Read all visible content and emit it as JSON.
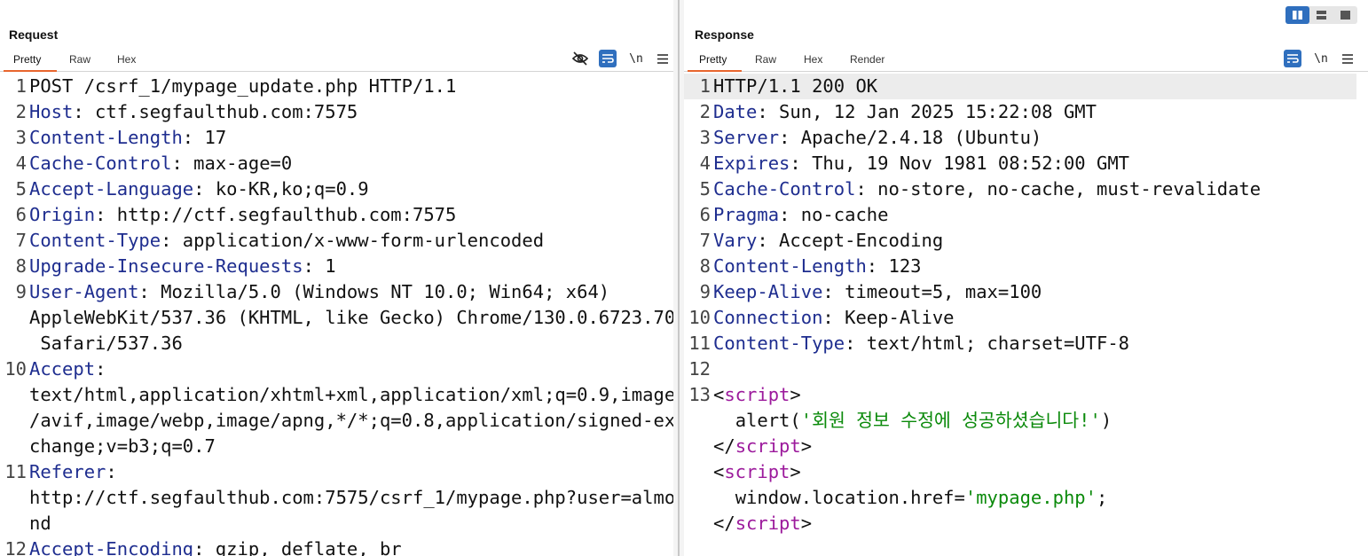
{
  "request": {
    "title": "Request",
    "tabs": [
      "Pretty",
      "Raw",
      "Hex"
    ],
    "icons": [
      "hide-icon",
      "wrap-icon",
      "newline-icon",
      "menu-icon"
    ],
    "newline_label": "\\n",
    "lines": [
      {
        "n": "1",
        "key": "",
        "val": "POST /csrf_1/mypage_update.php HTTP/1.1"
      },
      {
        "n": "2",
        "key": "Host",
        "val": ": ctf.segfaulthub.com:7575"
      },
      {
        "n": "3",
        "key": "Content-Length",
        "val": ": 17"
      },
      {
        "n": "4",
        "key": "Cache-Control",
        "val": ": max-age=0"
      },
      {
        "n": "5",
        "key": "Accept-Language",
        "val": ": ko-KR,ko;q=0.9"
      },
      {
        "n": "6",
        "key": "Origin",
        "val": ": http://ctf.segfaulthub.com:7575"
      },
      {
        "n": "7",
        "key": "Content-Type",
        "val": ": application/x-www-form-urlencoded"
      },
      {
        "n": "8",
        "key": "Upgrade-Insecure-Requests",
        "val": ": 1"
      },
      {
        "n": "9",
        "key": "User-Agent",
        "val": ": Mozilla/5.0 (Windows NT 10.0; Win64; x64)"
      },
      {
        "n": "",
        "key": "",
        "val": "AppleWebKit/537.36 (KHTML, like Gecko) Chrome/130.0.6723.70"
      },
      {
        "n": "",
        "key": "",
        "val": " Safari/537.36"
      },
      {
        "n": "10",
        "key": "Accept",
        "val": ":"
      },
      {
        "n": "",
        "key": "",
        "val": "text/html,application/xhtml+xml,application/xml;q=0.9,image"
      },
      {
        "n": "",
        "key": "",
        "val": "/avif,image/webp,image/apng,*/*;q=0.8,application/signed-ex"
      },
      {
        "n": "",
        "key": "",
        "val": "change;v=b3;q=0.7"
      },
      {
        "n": "11",
        "key": "Referer",
        "val": ":"
      },
      {
        "n": "",
        "key": "",
        "val": "http://ctf.segfaulthub.com:7575/csrf_1/mypage.php?user=almo"
      },
      {
        "n": "",
        "key": "",
        "val": "nd"
      },
      {
        "n": "12",
        "key": "Accept-Encoding",
        "val": ": gzip, deflate, br"
      }
    ]
  },
  "response": {
    "title": "Response",
    "tabs": [
      "Pretty",
      "Raw",
      "Hex",
      "Render"
    ],
    "newline_label": "\\n",
    "status_line": "HTTP/1.1 200 OK",
    "headers": [
      {
        "n": "2",
        "key": "Date",
        "val": ": Sun, 12 Jan 2025 15:22:08 GMT"
      },
      {
        "n": "3",
        "key": "Server",
        "val": ": Apache/2.4.18 (Ubuntu)"
      },
      {
        "n": "4",
        "key": "Expires",
        "val": ": Thu, 19 Nov 1981 08:52:00 GMT"
      },
      {
        "n": "5",
        "key": "Cache-Control",
        "val": ": no-store, no-cache, must-revalidate"
      },
      {
        "n": "6",
        "key": "Pragma",
        "val": ": no-cache"
      },
      {
        "n": "7",
        "key": "Vary",
        "val": ": Accept-Encoding"
      },
      {
        "n": "8",
        "key": "Content-Length",
        "val": ": 123"
      },
      {
        "n": "9",
        "key": "Keep-Alive",
        "val": ": timeout=5, max=100"
      },
      {
        "n": "10",
        "key": "Connection",
        "val": ": Keep-Alive"
      },
      {
        "n": "11",
        "key": "Content-Type",
        "val": ": text/html; charset=UTF-8"
      }
    ],
    "body": {
      "line_12": "12",
      "line_13": "13",
      "lt": "<",
      "gt": ">",
      "close_lt": "</",
      "tag": "script",
      "alert_fn": "alert(",
      "alert_str": "'회원 정보 수정에 성공하셨습니다!'",
      "alert_end": ")",
      "loc_fn": "window.location.href=",
      "loc_str": "'mypage.php'",
      "loc_end": ";"
    }
  },
  "layout_toggle": [
    "split-horizontal-icon",
    "split-vertical-icon",
    "single-pane-icon"
  ]
}
